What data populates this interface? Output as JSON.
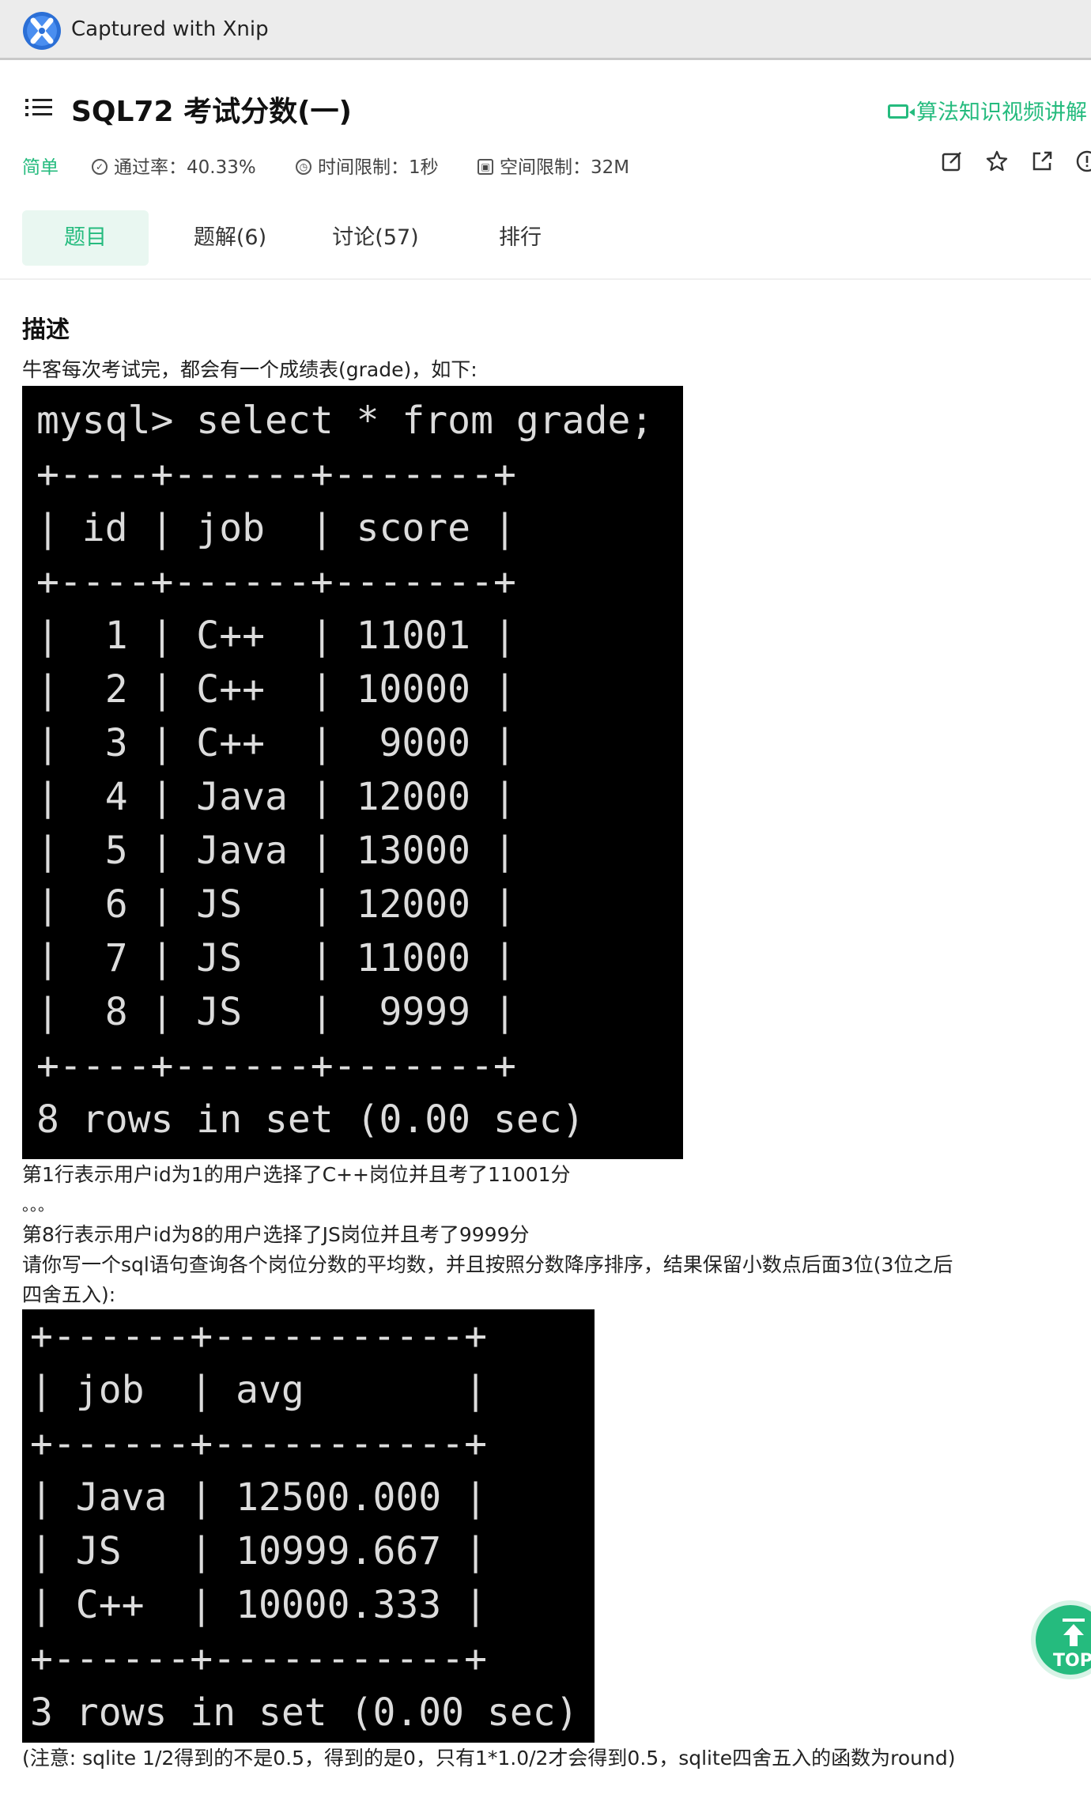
{
  "capture_bar": {
    "text": "Captured with Xnip"
  },
  "header": {
    "title": "SQL72  考试分数(一)",
    "video_link": "算法知识视频讲解"
  },
  "meta": {
    "difficulty": "简单",
    "pass_rate": "通过率：40.33%",
    "time_limit": "时间限制：1秒",
    "space_limit": "空间限制：32M"
  },
  "tabs": [
    {
      "label": "题目"
    },
    {
      "label": "题解(6)"
    },
    {
      "label": "讨论(57)"
    },
    {
      "label": "排行"
    }
  ],
  "content": {
    "heading": "描述",
    "intro": "牛客每次考试完，都会有一个成绩表(grade)，如下:",
    "terminal1": "mysql> select * from grade;\n+----+------+-------+\n| id | job  | score |\n+----+------+-------+\n|  1 | C++  | 11001 |\n|  2 | C++  | 10000 |\n|  3 | C++  |  9000 |\n|  4 | Java | 12000 |\n|  5 | Java | 13000 |\n|  6 | JS   | 12000 |\n|  7 | JS   | 11000 |\n|  8 | JS   |  9999 |\n+----+------+-------+\n8 rows in set (0.00 sec)",
    "line1": "第1行表示用户id为1的用户选择了C++岗位并且考了11001分",
    "line2": "。。。",
    "line3": "第8行表示用户id为8的用户选择了JS岗位并且考了9999分",
    "line4": "请你写一个sql语句查询各个岗位分数的平均数，并且按照分数降序排序，结果保留小数点后面3位(3位之后",
    "line5": "四舍五入):",
    "terminal2": "+------+-----------+\n| job  | avg       |\n+------+-----------+\n| Java | 12500.000 |\n| JS   | 10999.667 |\n| C++  | 10000.333 |\n+------+-----------+\n3 rows in set (0.00 sec)",
    "note": "(注意: sqlite 1/2得到的不是0.5，得到的是0，只有1*1.0/2才会得到0.5，sqlite四舍五入的函数为round)"
  },
  "top_button": {
    "label": "TOP"
  },
  "colors": {
    "accent": "#25bb7e",
    "terminal_bg": "#000000"
  }
}
